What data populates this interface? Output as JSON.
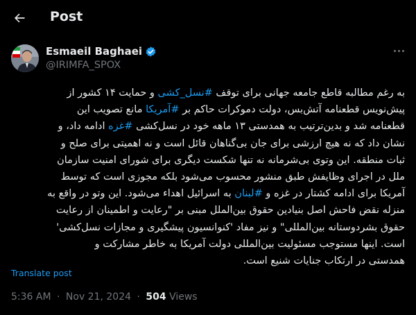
{
  "header": {
    "title": "Post",
    "back_icon": "arrow-left-icon"
  },
  "author": {
    "name": "Esmaeil Baghaei",
    "handle": "@IRIMFA_SPOX",
    "verified_icon": "verified-badge-icon",
    "avatar_icon": "avatar"
  },
  "more_icon": "more-horizontal-icon",
  "tweet": {
    "lines": [
      [
        {
          "t": "به رغم مطالبه قاطع جامعه جهانی برای توقف "
        },
        {
          "t": "#نسل_کشی",
          "link": true
        },
        {
          "t": " و حمایت ۱۴ کشور از"
        }
      ],
      [
        {
          "t": "پیش‌نویس قطعنامه آتش‌بس، دولت دموکرات حاکم بر "
        },
        {
          "t": "#آمریکا",
          "link": true
        },
        {
          "t": " مانع تصویب این"
        }
      ],
      [
        {
          "t": "قطعنامه شد و بدین‌ترتیب به همدستی ۱۳ ماهه خود در نسل‌کشی "
        },
        {
          "t": "#غزه",
          "link": true
        },
        {
          "t": " ادامه داد، و"
        }
      ],
      [
        {
          "t": "نشان داد که نه هیچ ارزشی برای جان بی‌گناهان قائل است و نه اهمیتی برای صلح و"
        }
      ],
      [
        {
          "t": "ثبات منطقه. این وتوی بی‌شرمانه نه تنها شکست دیگری برای شورای امنیت سازمان"
        }
      ],
      [
        {
          "t": "ملل در اجرای وظایفش طبق منشور محسوب می‌شود بلکه مجوزی است که توسط"
        }
      ],
      [
        {
          "t": "آمریکا برای ادامه کشتار در غزه و "
        },
        {
          "t": "#لبنان",
          "link": true
        },
        {
          "t": " به اسرائیل اهداء می‌شود. این وتو در واقع به"
        }
      ],
      [
        {
          "t": "منزله نقض فاحش اصل بنیادین حقوق بین‌الملل مبنی بر \"رعایت و اطمینان از رعایت"
        }
      ],
      [
        {
          "t": "حقوق بشردوستانه بین‌المللی\" و نیز مفاد 'کنوانسیون پیشگیری و مجازات نسل‌کشی'"
        }
      ],
      [
        {
          "t": "است. اینها مستوجب مسئولیت بین‌المللی دولت آمریکا به خاطر مشارکت و"
        }
      ],
      [
        {
          "t": "همدستی در ارتکاب جنایات شنیع است."
        }
      ]
    ]
  },
  "translate_label": "Translate post",
  "meta": {
    "time": "5:36 AM",
    "date": "Nov 21, 2024",
    "separator": "·",
    "views_count": "504",
    "views_label": "Views"
  }
}
